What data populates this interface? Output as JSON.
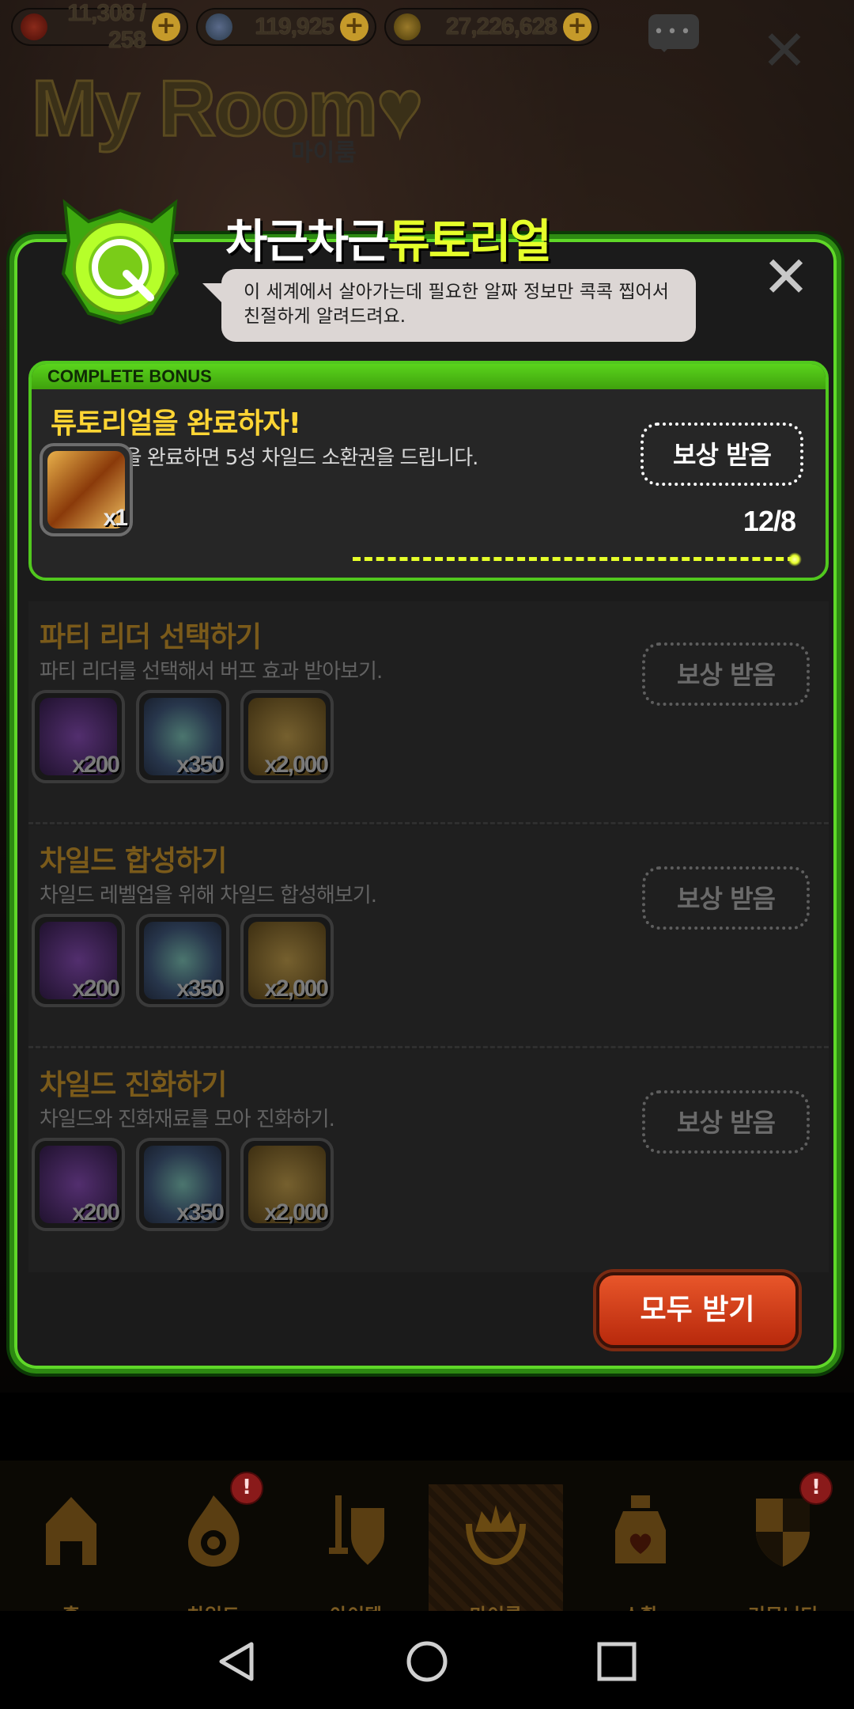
{
  "topbar": {
    "hearts": "11,308 / 258",
    "gems": "119,925",
    "coins": "27,226,628",
    "plus": "+"
  },
  "chat_icon": "•••",
  "close_glyph": "✕",
  "room": {
    "title": "My Room♥",
    "subtitle": "마이룸"
  },
  "popup": {
    "title_pre": "차근차근",
    "title_hl": "튜토리얼",
    "speech": "이 세계에서 살아가는데 필요한 알짜 정보만 콕콕 찝어서 친절하게 알려드려요."
  },
  "bonus": {
    "header": "COMPLETE BONUS",
    "title": "튜토리얼을 완료하자!",
    "desc": "튜토리얼을 완료하면 5성 차일드 소환권을 드립니다.",
    "button": "보상 받음",
    "count": "12/8",
    "reward_qty": "x1"
  },
  "quests": [
    {
      "title": "파티 리더 선택하기",
      "desc": "파티 리더를 선택해서 버프 효과 받아보기.",
      "button": "보상 받음",
      "rewards": [
        "x200",
        "x350",
        "x2,000"
      ]
    },
    {
      "title": "차일드 합성하기",
      "desc": "차일드 레벨업을 위해 차일드 합성해보기.",
      "button": "보상 받음",
      "rewards": [
        "x200",
        "x350",
        "x2,000"
      ]
    },
    {
      "title": "차일드 진화하기",
      "desc": "차일드와 진화재료를 모아 진화하기.",
      "button": "보상 받음",
      "rewards": [
        "x200",
        "x350",
        "x2,000"
      ]
    }
  ],
  "receive_all": "모두 받기",
  "nav": [
    {
      "label": "홈"
    },
    {
      "label": "차일드",
      "alert": "!"
    },
    {
      "label": "아이템"
    },
    {
      "label": "마이룸"
    },
    {
      "label": "소환"
    },
    {
      "label": "커뮤니티",
      "alert": "!"
    }
  ],
  "colors": {
    "accent_green": "#5fd828",
    "title_yellow": "#e6ff2a",
    "bonus_title": "#ffd534",
    "button_red": "#c8340f"
  }
}
